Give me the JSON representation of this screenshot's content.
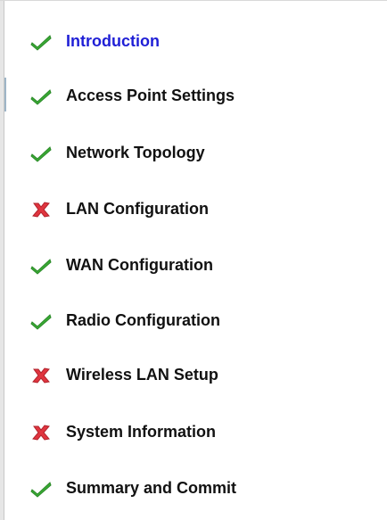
{
  "wizard": {
    "steps": [
      {
        "label": "Introduction",
        "status": "complete",
        "icon": "check-icon",
        "active": true
      },
      {
        "label": "Access Point Settings",
        "status": "complete",
        "icon": "check-icon",
        "active": false
      },
      {
        "label": "Network Topology",
        "status": "complete",
        "icon": "check-icon",
        "active": false
      },
      {
        "label": "LAN Configuration",
        "status": "error",
        "icon": "cross-icon",
        "active": false
      },
      {
        "label": "WAN Configuration",
        "status": "complete",
        "icon": "check-icon",
        "active": false
      },
      {
        "label": "Radio Configuration",
        "status": "complete",
        "icon": "check-icon",
        "active": false
      },
      {
        "label": "Wireless LAN Setup",
        "status": "error",
        "icon": "cross-icon",
        "active": false
      },
      {
        "label": "System Information",
        "status": "error",
        "icon": "cross-icon",
        "active": false
      },
      {
        "label": "Summary and Commit",
        "status": "complete",
        "icon": "check-icon",
        "active": false
      }
    ]
  },
  "colors": {
    "active_label": "#1f1fd6",
    "label": "#111111",
    "check": "#3aaa35",
    "cross": "#e0353f"
  }
}
